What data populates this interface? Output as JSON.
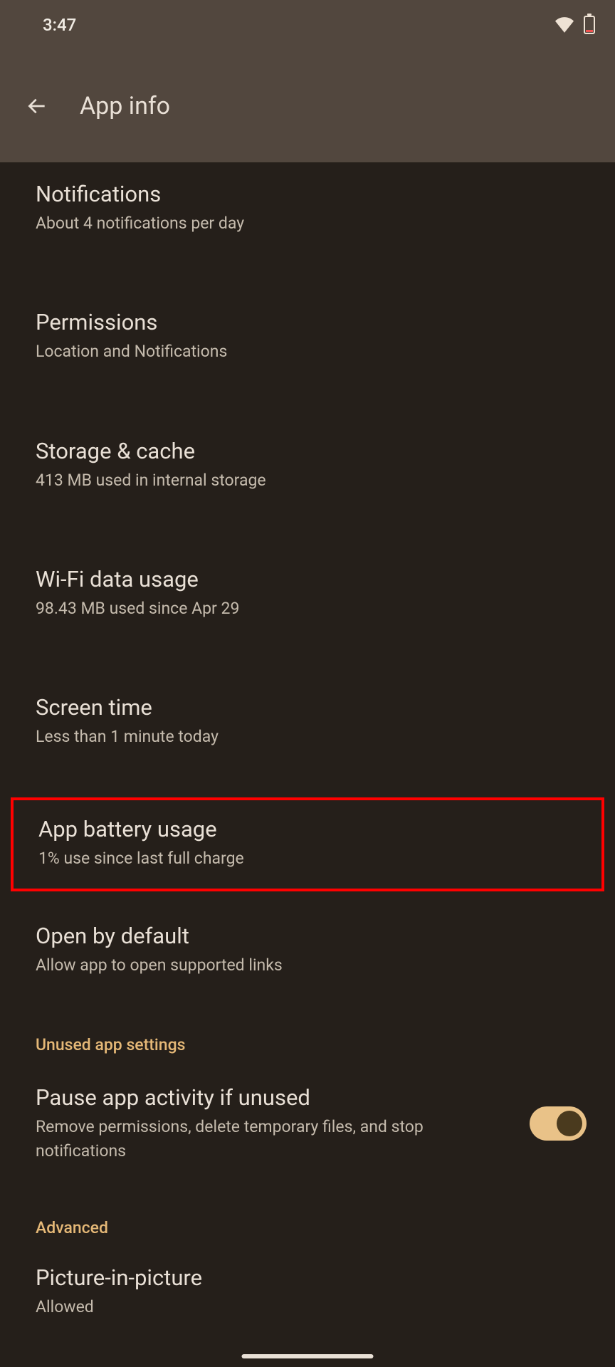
{
  "status": {
    "time": "3:47"
  },
  "header": {
    "title": "App info"
  },
  "settings": [
    {
      "title": "Notifications",
      "subtitle": "About 4 notifications per day"
    },
    {
      "title": "Permissions",
      "subtitle": "Location and Notifications"
    },
    {
      "title": "Storage & cache",
      "subtitle": "413 MB used in internal storage"
    },
    {
      "title": "Wi-Fi data usage",
      "subtitle": "98.43 MB used since Apr 29"
    },
    {
      "title": "Screen time",
      "subtitle": "Less than 1 minute today"
    },
    {
      "title": "App battery usage",
      "subtitle": "1% use since last full charge"
    },
    {
      "title": "Open by default",
      "subtitle": "Allow app to open supported links"
    }
  ],
  "sections": {
    "unused": "Unused app settings",
    "advanced": "Advanced"
  },
  "pause": {
    "title": "Pause app activity if unused",
    "subtitle": "Remove permissions, delete temporary files, and stop notifications",
    "enabled": true
  },
  "pip": {
    "title": "Picture-in-picture",
    "subtitle": "Allowed"
  }
}
